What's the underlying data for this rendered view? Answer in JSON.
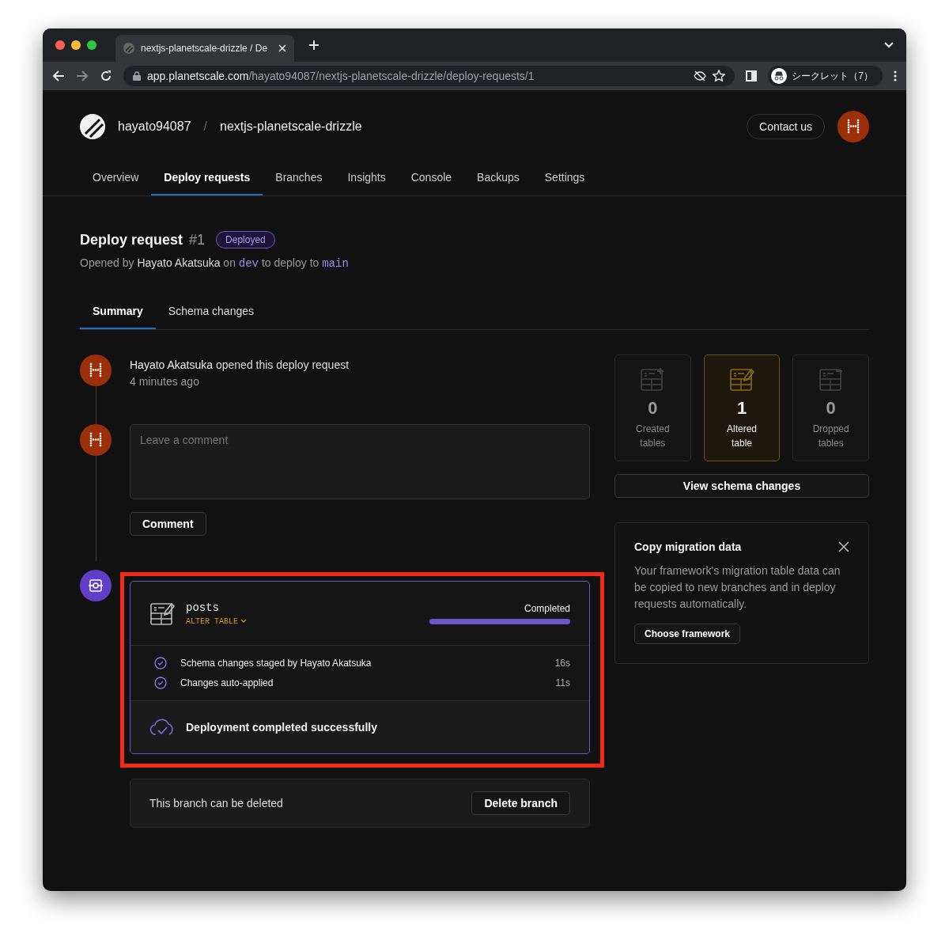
{
  "browser": {
    "tab_title": "nextjs-planetscale-drizzle / De",
    "url_host": "app.planetscale.com",
    "url_path": "/hayato94087/nextjs-planetscale-drizzle/deploy-requests/1",
    "profile": "シークレット（7）"
  },
  "header": {
    "org": "hayato94087",
    "separator": "/",
    "database": "nextjs-planetscale-drizzle",
    "contact": "Contact us"
  },
  "nav": [
    {
      "label": "Overview",
      "selected": false
    },
    {
      "label": "Deploy requests",
      "selected": true
    },
    {
      "label": "Branches",
      "selected": false
    },
    {
      "label": "Insights",
      "selected": false
    },
    {
      "label": "Console",
      "selected": false
    },
    {
      "label": "Backups",
      "selected": false
    },
    {
      "label": "Settings",
      "selected": false
    }
  ],
  "request": {
    "title": "Deploy request",
    "number": "#1",
    "status": "Deployed",
    "opened_by": "Opened by",
    "author": "Hayato Akatsuka",
    "on": "on",
    "source_branch": "dev",
    "to": "to deploy to",
    "target_branch": "main"
  },
  "subtabs": [
    {
      "label": "Summary",
      "selected": true
    },
    {
      "label": "Schema changes",
      "selected": false
    }
  ],
  "event": {
    "author": "Hayato Akatsuka",
    "action": "opened this deploy request",
    "time": "4 minutes ago"
  },
  "comment": {
    "placeholder": "Leave a comment",
    "button": "Comment"
  },
  "deployment": {
    "table": "posts",
    "operation": "ALTER TABLE",
    "status": "Completed",
    "level": 1,
    "steps": [
      {
        "text": "Schema changes staged by Hayato Akatsuka",
        "duration": "16s",
        "done": true
      },
      {
        "text": "Changes auto-applied",
        "duration": "11s",
        "done": true
      }
    ],
    "result": "Deployment completed successfully"
  },
  "branch_notice": {
    "text": "This branch can be deleted",
    "button": "Delete branch"
  },
  "stats": [
    {
      "kind": "created",
      "count": "0",
      "label": "Created tables",
      "selected": false
    },
    {
      "kind": "altered",
      "count": "1",
      "label": "Altered table",
      "selected": true
    },
    {
      "kind": "dropped",
      "count": "0",
      "label": "Dropped tables",
      "selected": false
    }
  ],
  "view_button": "View schema changes",
  "migration": {
    "title": "Copy migration data",
    "body": "Your framework's migration table data can be copied to new branches and in deploy requests automatically.",
    "button": "Choose framework"
  }
}
